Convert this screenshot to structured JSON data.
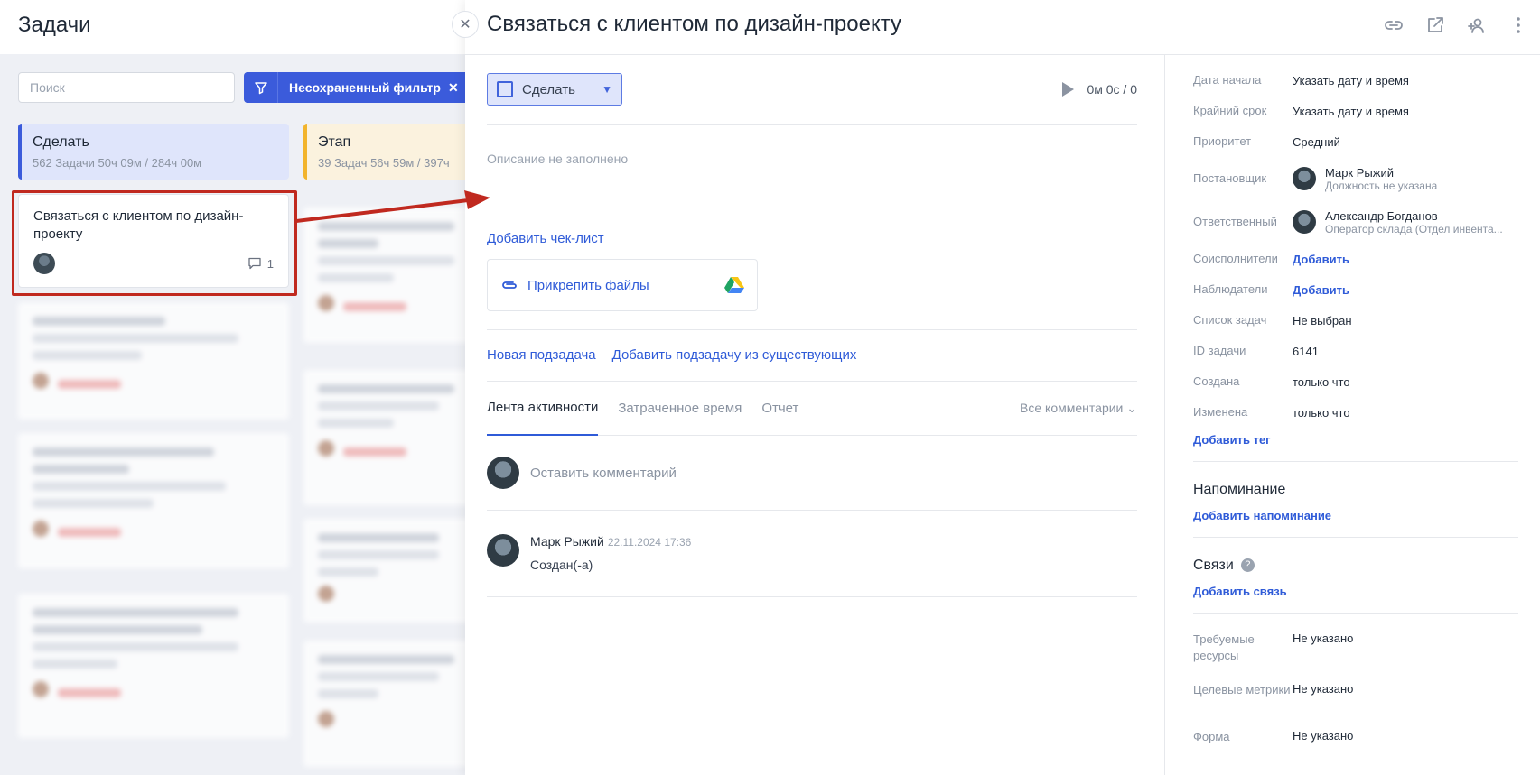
{
  "board": {
    "title": "Задачи",
    "search_placeholder": "Поиск",
    "filter_label": "Несохраненный фильтр",
    "columns": [
      {
        "name": "Сделать",
        "stats": "562 Задачи   50ч 09м / 284ч 00м"
      },
      {
        "name": "Этап",
        "stats": "39 Задач   56ч 59м / 397ч"
      }
    ],
    "card": {
      "title": "Связаться с клиентом по дизайн-проекту",
      "comments": "1"
    }
  },
  "panel": {
    "title": "Связаться с клиентом по дизайн-проекту",
    "status": "Сделать",
    "timer": "0м 0с / 0",
    "description_placeholder": "Описание не заполнено",
    "add_checklist": "Добавить чек-лист",
    "attach_files": "Прикрепить файлы",
    "new_subtask": "Новая подзадача",
    "add_existing_subtask": "Добавить подзадачу из существующих",
    "tabs": [
      "Лента активности",
      "Затраченное время",
      "Отчет"
    ],
    "all_comments": "Все комментарии",
    "comment_placeholder": "Оставить комментарий",
    "activity": {
      "author": "Марк Рыжий",
      "date": "22.11.2024 17:36",
      "text": "Создан(-а)"
    }
  },
  "props": {
    "start_label": "Дата начала",
    "start_value": "Указать дату и время",
    "deadline_label": "Крайний срок",
    "deadline_value": "Указать дату и время",
    "priority_label": "Приоритет",
    "priority_value": "Средний",
    "author_label": "Постановщик",
    "author_name": "Марк Рыжий",
    "author_role": "Должность не указана",
    "assignee_label": "Ответственный",
    "assignee_name": "Александр Богданов",
    "assignee_role": "Оператор склада (Отдел инвента...",
    "coexec_label": "Соисполнители",
    "coexec_value": "Добавить",
    "watchers_label": "Наблюдатели",
    "watchers_value": "Добавить",
    "list_label": "Список задач",
    "list_value": "Не выбран",
    "id_label": "ID задачи",
    "id_value": "6141",
    "created_label": "Создана",
    "created_value": "только что",
    "changed_label": "Изменена",
    "changed_value": "только что",
    "add_tag": "Добавить тег",
    "reminder_title": "Напоминание",
    "add_reminder": "Добавить напоминание",
    "links_title": "Связи",
    "add_link": "Добавить связь",
    "resources_label": "Требуемые ресурсы",
    "resources_value": "Не указано",
    "metrics_label": "Целевые метрики",
    "metrics_value": "Не указано",
    "form_label": "Форма",
    "form_value": "Не указано"
  }
}
